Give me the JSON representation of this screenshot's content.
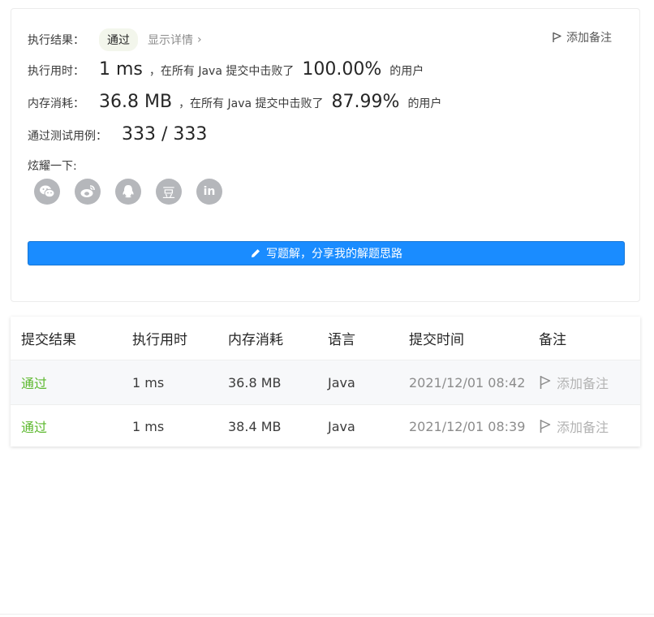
{
  "result": {
    "label": "执行结果：",
    "status": "通过",
    "detail_link": "显示详情",
    "add_note": "添加备注"
  },
  "runtime": {
    "label": "执行用时：",
    "value": "1 ms",
    "beat_text": "，在所有 Java 提交中击败了",
    "percent": "100.00%",
    "suffix": "的用户"
  },
  "memory": {
    "label": "内存消耗：",
    "value": "36.8 MB",
    "beat_text": "，在所有 Java 提交中击败了",
    "percent": "87.99%",
    "suffix": "的用户"
  },
  "tests": {
    "label": "通过测试用例：",
    "value": "333 / 333"
  },
  "share": {
    "label": "炫耀一下:",
    "icons": [
      "wechat-icon",
      "weibo-icon",
      "qq-icon",
      "douban-icon",
      "linkedin-icon"
    ],
    "douban_glyph": "豆",
    "linkedin_glyph": "in"
  },
  "write_solution": "写题解，分享我的解题思路",
  "submissions": {
    "headers": [
      "提交结果",
      "执行用时",
      "内存消耗",
      "语言",
      "提交时间",
      "备注"
    ],
    "rows": [
      {
        "status": "通过",
        "runtime": "1 ms",
        "memory": "36.8 MB",
        "language": "Java",
        "time": "2021/12/01 08:42",
        "note": "添加备注"
      },
      {
        "status": "通过",
        "runtime": "1 ms",
        "memory": "38.4 MB",
        "language": "Java",
        "time": "2021/12/01 08:39",
        "note": "添加备注"
      }
    ]
  },
  "colors": {
    "accent_blue": "#1a8cff",
    "pass_green": "#5cb82e",
    "icon_gray": "#b5b7bb"
  }
}
